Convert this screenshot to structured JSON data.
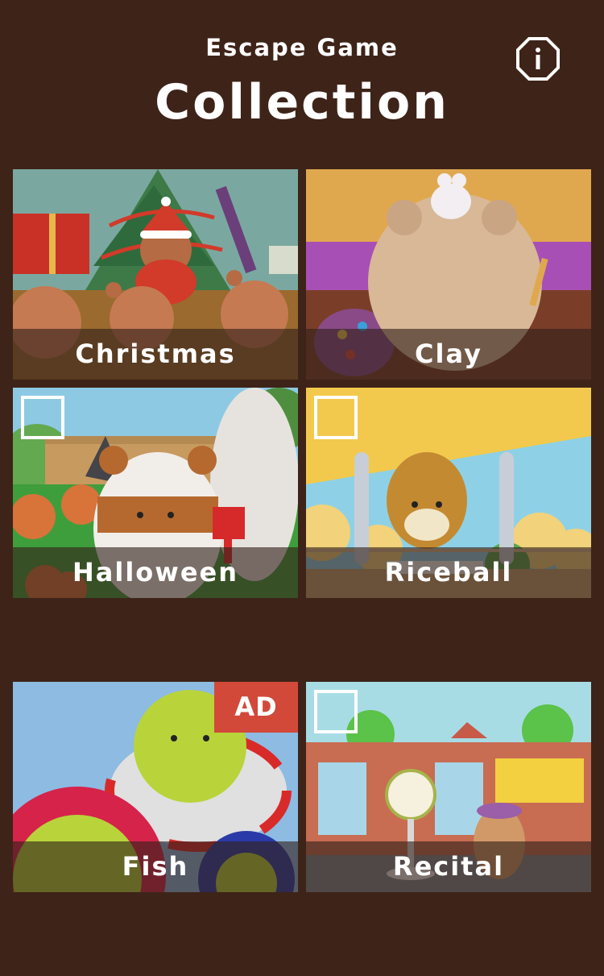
{
  "header": {
    "subtitle": "Escape Game",
    "title": "Collection",
    "info_icon": "info-icon"
  },
  "colors": {
    "background": "#3e2318",
    "label_bar": "#32201a",
    "ad_badge": "#d2493a"
  },
  "tiles": [
    {
      "label": "Christmas",
      "checkbox": false,
      "badge": ""
    },
    {
      "label": "Clay",
      "checkbox": false,
      "badge": ""
    },
    {
      "label": "Halloween",
      "checkbox": true,
      "badge": ""
    },
    {
      "label": "Riceball",
      "checkbox": true,
      "badge": ""
    },
    {
      "label": "Fish",
      "checkbox": false,
      "badge": "AD"
    },
    {
      "label": "Recital",
      "checkbox": true,
      "badge": ""
    }
  ]
}
